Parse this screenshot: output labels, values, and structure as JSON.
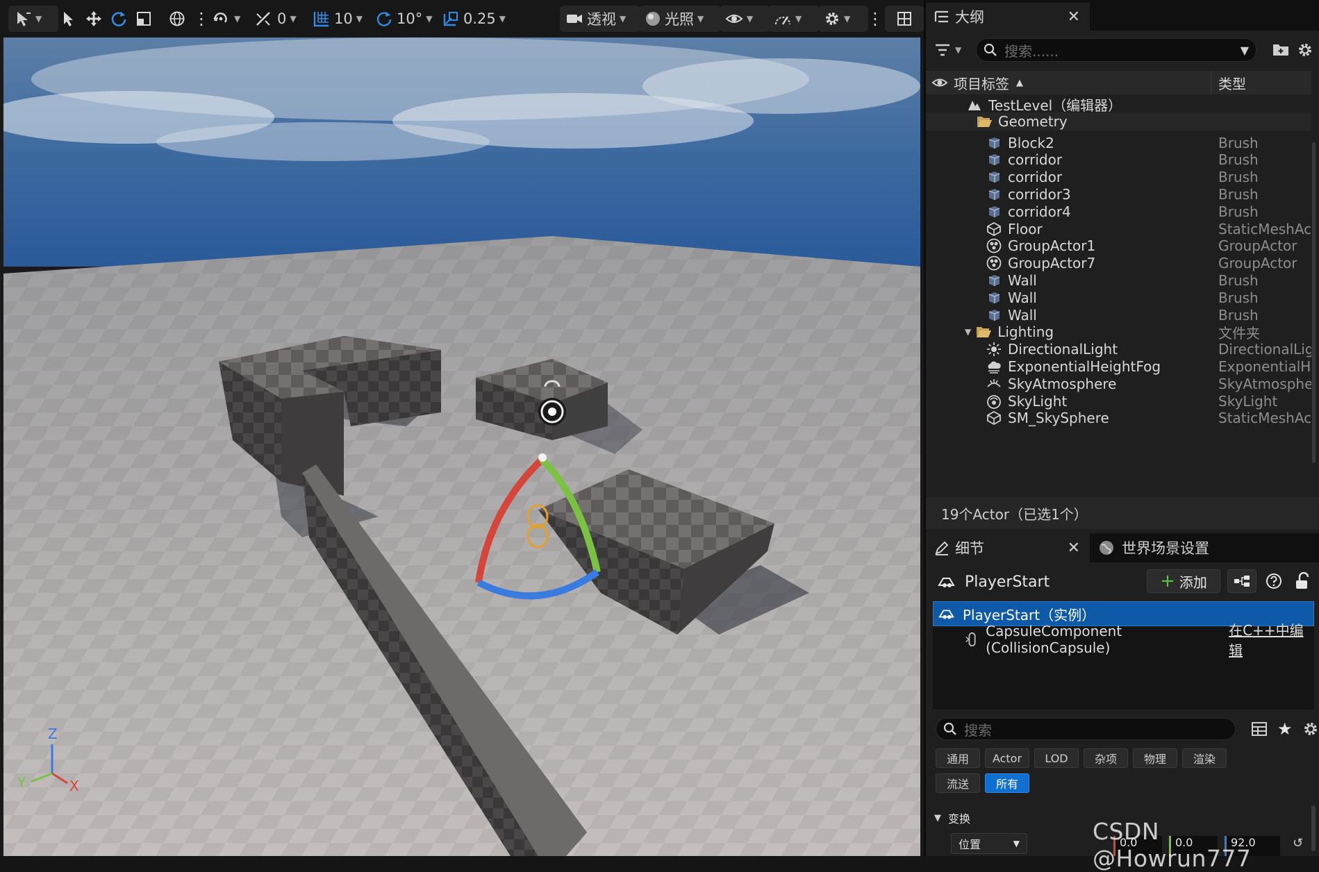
{
  "viewport": {
    "toolbar": {
      "rotate_snap_value": "0",
      "grid_snap_value": "10",
      "angle_snap_value": "10°",
      "scale_snap_value": "0.25",
      "view_mode_label": "透视",
      "lighting_label": "光照"
    },
    "axis_labels": {
      "z": "Z",
      "y": "Y",
      "x": "X"
    }
  },
  "outliner": {
    "tab_label": "大纲",
    "search_placeholder": "搜索......",
    "col_label": "项目标签",
    "col_type": "类型",
    "rows": [
      {
        "name": "TestLevel（编辑器）",
        "type": "",
        "icon": "level-icon"
      },
      {
        "name": "Geometry",
        "type": "",
        "icon": "folder-open-icon"
      },
      {
        "name": "Block2",
        "type": "Brush",
        "icon": "brush-icon"
      },
      {
        "name": "corridor",
        "type": "Brush",
        "icon": "brush-icon"
      },
      {
        "name": "corridor",
        "type": "Brush",
        "icon": "brush-icon"
      },
      {
        "name": "corridor3",
        "type": "Brush",
        "icon": "brush-icon"
      },
      {
        "name": "corridor4",
        "type": "Brush",
        "icon": "brush-icon"
      },
      {
        "name": "Floor",
        "type": "StaticMeshActor",
        "icon": "static-mesh-icon"
      },
      {
        "name": "GroupActor1",
        "type": "GroupActor",
        "icon": "group-actor-icon"
      },
      {
        "name": "GroupActor7",
        "type": "GroupActor",
        "icon": "group-actor-icon"
      },
      {
        "name": "Wall",
        "type": "Brush",
        "icon": "brush-icon"
      },
      {
        "name": "Wall",
        "type": "Brush",
        "icon": "brush-icon"
      },
      {
        "name": "Wall",
        "type": "Brush",
        "icon": "brush-icon"
      },
      {
        "name": "Lighting",
        "type": "文件夹",
        "icon": "folder-open-icon"
      },
      {
        "name": "DirectionalLight",
        "type": "DirectionalLight",
        "icon": "directional-light-icon"
      },
      {
        "name": "ExponentialHeightFog",
        "type": "ExponentialHeightFog",
        "icon": "fog-icon"
      },
      {
        "name": "SkyAtmosphere",
        "type": "SkyAtmosphere",
        "icon": "sky-atmosphere-icon"
      },
      {
        "name": "SkyLight",
        "type": "SkyLight",
        "icon": "sky-light-icon"
      },
      {
        "name": "SM_SkySphere",
        "type": "StaticMeshActor",
        "icon": "static-mesh-icon"
      }
    ],
    "status": "19个Actor（已选1个）"
  },
  "details": {
    "tab_label": "细节",
    "world_tab_label": "世界场景设置",
    "actor_name": "PlayerStart",
    "add_label": "添加",
    "instance_label": "PlayerStart（实例）",
    "component_label": "CapsuleComponent (CollisionCapsule)",
    "edit_cpp_label": "在C++中编辑",
    "search_placeholder": "搜索",
    "filters": [
      "通用",
      "Actor",
      "LOD",
      "杂项",
      "物理",
      "渲染",
      "流送",
      "所有"
    ],
    "active_filter": "所有",
    "section_transform": "变换",
    "location_label": "位置",
    "location": {
      "x": "0.0",
      "y": "0.0",
      "z": "92.0"
    }
  },
  "watermark": "CSDN @Howrun777",
  "colors": {
    "accent": "#0f70d1",
    "selected_row": "#0f5aa8",
    "gizmo_x": "#d6453a",
    "gizmo_y": "#7cc242",
    "gizmo_z": "#3a7be0"
  }
}
